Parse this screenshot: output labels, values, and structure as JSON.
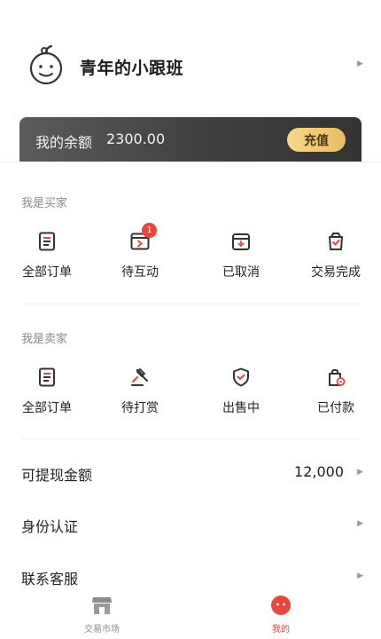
{
  "profile": {
    "nickname": "青年的小跟班",
    "avatar_icon": "baby-face-icon"
  },
  "balance": {
    "label": "我的余额",
    "value": "2300.00",
    "recharge_label": "充值"
  },
  "buyer": {
    "title": "我是买家",
    "items": [
      {
        "label": "全部订单",
        "icon": "order-list-icon"
      },
      {
        "label": "待互动",
        "icon": "pending-interact-icon",
        "badge": "1"
      },
      {
        "label": "已取消",
        "icon": "cancelled-box-icon"
      },
      {
        "label": "交易完成",
        "icon": "completed-bag-icon"
      }
    ]
  },
  "seller": {
    "title": "我是卖家",
    "items": [
      {
        "label": "全部订单",
        "icon": "order-list-icon"
      },
      {
        "label": "待打赏",
        "icon": "auction-hammer-icon"
      },
      {
        "label": "出售中",
        "icon": "shield-check-icon"
      },
      {
        "label": "已付款",
        "icon": "paid-bag-icon"
      }
    ]
  },
  "menu": [
    {
      "label": "可提现金额",
      "value": "12,000"
    },
    {
      "label": "身份认证"
    },
    {
      "label": "联系客服"
    }
  ],
  "tabs": [
    {
      "label": "交易市场",
      "icon": "shop-icon",
      "active": false
    },
    {
      "label": "我的",
      "icon": "me-face-icon",
      "active": true
    }
  ],
  "colors": {
    "accent": "#e8453c",
    "gold": "#eec471",
    "card_dark": "#3f3f3f"
  }
}
